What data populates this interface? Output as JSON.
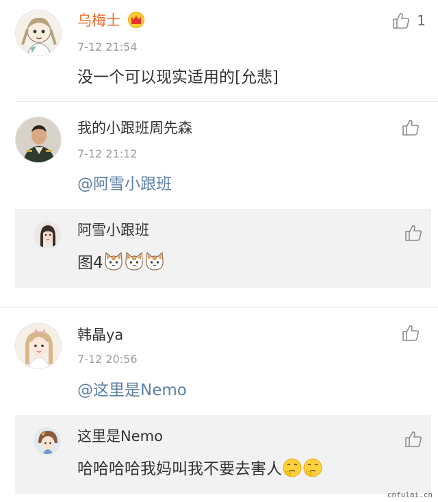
{
  "comments": [
    {
      "username": "乌梅士",
      "time": "7-12 21:54",
      "text": "没一个可以现实适用的[允悲]",
      "likes": "1",
      "username_color": "#f06a2a",
      "badge": "crown-icon"
    },
    {
      "username": "我的小跟班周先森",
      "time": "7-12 21:12",
      "text": "@阿雪小跟班",
      "reply": {
        "username": "阿雪小跟班",
        "text": "图4"
      }
    },
    {
      "username": "韩晶ya",
      "time": "7-12 20:56",
      "text": "@这里是Nemo",
      "reply": {
        "username": "这里是Nemo",
        "text": "哈哈哈哈我妈叫我不要去害人"
      }
    }
  ],
  "watermark": "cnfulai.cn",
  "colors": {
    "mention": "#5b7fa6",
    "reply_bg": "#f2f2f2",
    "divider": "#e8e8e8"
  }
}
